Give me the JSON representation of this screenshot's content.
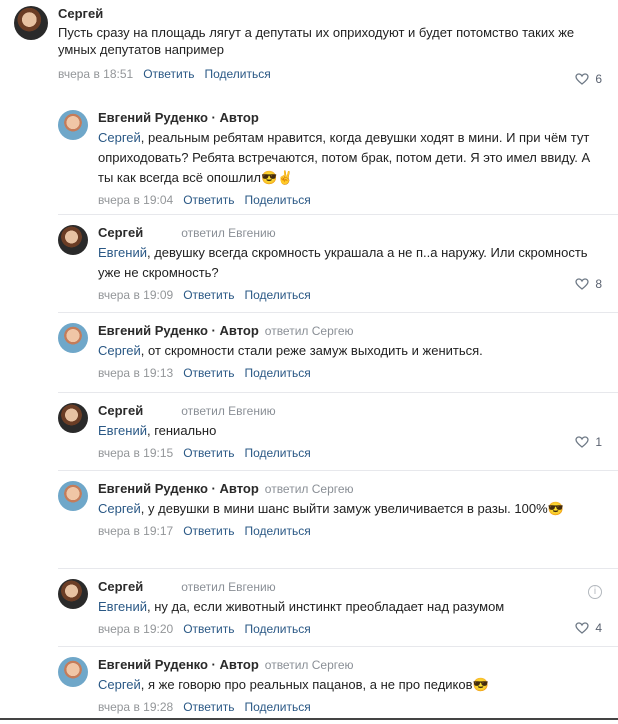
{
  "comments": [
    {
      "author": "Сергей",
      "text": "Пусть сразу на площадь лягут а депутаты их оприходуют и будет потомство таких же умных депутатов например",
      "time": "вчера в 18:51",
      "reply": "Ответить",
      "share": "Поделиться",
      "likes": "6"
    },
    {
      "author": "Евгений Руденко · Автор",
      "mention": "Сергей",
      "text": ", реальным ребятам нравится, когда девушки ходят в мини. И при чём тут оприходовать? Ребята встречаются, потом брак, потом дети. Я это имел ввиду. А ты как всегда всё опошлил😎✌",
      "time": "вчера в 19:04",
      "reply": "Ответить",
      "share": "Поделиться"
    },
    {
      "author": "Сергей",
      "replied": "ответил Евгению",
      "mention": "Евгений",
      "text": ", девушку всегда скромность украшала а не п..а наружу. Или скромность уже не скромность?",
      "time": "вчера в 19:09",
      "reply": "Ответить",
      "share": "Поделиться",
      "likes": "8"
    },
    {
      "author": "Евгений Руденко · Автор",
      "replied": "ответил Сергею",
      "mention": "Сергей",
      "text": ", от скромности стали реже замуж выходить и жениться.",
      "time": "вчера в 19:13",
      "reply": "Ответить",
      "share": "Поделиться"
    },
    {
      "author": "Сергей",
      "replied": "ответил Евгению",
      "mention": "Евгений",
      "text": ", гениально",
      "time": "вчера в 19:15",
      "reply": "Ответить",
      "share": "Поделиться",
      "likes": "1"
    },
    {
      "author": "Евгений Руденко · Автор",
      "replied": "ответил Сергею",
      "mention": "Сергей",
      "text": ", у девушки в мини шанс выйти замуж увеличивается в разы. 100%😎",
      "time": "вчера в 19:17",
      "reply": "Ответить",
      "share": "Поделиться"
    },
    {
      "author": "Сергей",
      "replied": "ответил Евгению",
      "mention": "Евгений",
      "text": ", ну да, если животный инстинкт преобладает над разумом",
      "time": "вчера в 19:20",
      "reply": "Ответить",
      "share": "Поделиться",
      "likes": "4"
    },
    {
      "author": "Евгений Руденко · Автор",
      "replied": "ответил Сергею",
      "mention": "Сергей",
      "text": ", я же говорю про реальных пацанов, а не про педиков😎",
      "time": "вчера в 19:28",
      "reply": "Ответить",
      "share": "Поделиться"
    }
  ]
}
